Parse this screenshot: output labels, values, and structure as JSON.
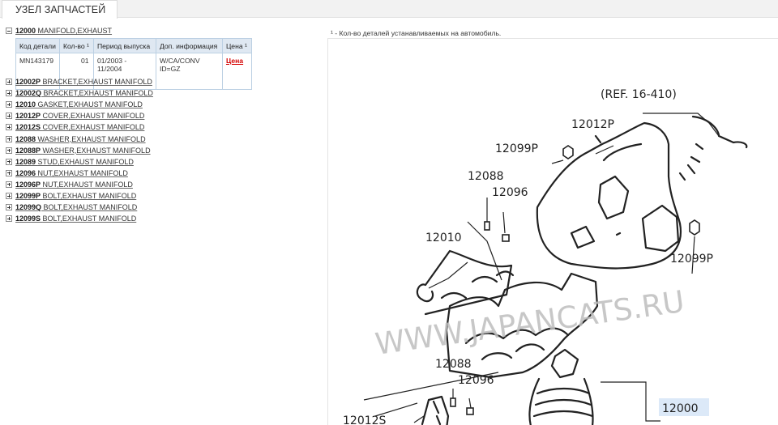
{
  "tab": {
    "label": "УЗЕЛ ЗАПЧАСТЕЙ"
  },
  "tree": {
    "expanded": {
      "code": "12000",
      "name": "MANIFOLD,EXHAUST"
    },
    "table": {
      "headers": [
        "Код детали",
        "Кол-во ¹",
        "Период выпуска",
        "Доп. информация",
        "Цена ¹"
      ],
      "rows": [
        {
          "part": "MN143179",
          "qty": "01",
          "period": "01/2003 - 11/2004",
          "info": "W/CA/CONV ID=GZ",
          "price": "Цена"
        }
      ]
    },
    "items": [
      {
        "code": "12002P",
        "name": "BRACKET,EXHAUST MANIFOLD"
      },
      {
        "code": "12002Q",
        "name": "BRACKET,EXHAUST MANIFOLD"
      },
      {
        "code": "12010",
        "name": "GASKET,EXHAUST MANIFOLD"
      },
      {
        "code": "12012P",
        "name": "COVER,EXHAUST MANIFOLD"
      },
      {
        "code": "12012S",
        "name": "COVER,EXHAUST MANIFOLD"
      },
      {
        "code": "12088",
        "name": "WASHER,EXHAUST MANIFOLD"
      },
      {
        "code": "12088P",
        "name": "WASHER,EXHAUST MANIFOLD"
      },
      {
        "code": "12089",
        "name": "STUD,EXHAUST MANIFOLD"
      },
      {
        "code": "12096",
        "name": "NUT,EXHAUST MANIFOLD"
      },
      {
        "code": "12096P",
        "name": "NUT,EXHAUST MANIFOLD"
      },
      {
        "code": "12099P",
        "name": "BOLT,EXHAUST MANIFOLD"
      },
      {
        "code": "12099Q",
        "name": "BOLT,EXHAUST MANIFOLD"
      },
      {
        "code": "12099S",
        "name": "BOLT,EXHAUST MANIFOLD"
      }
    ]
  },
  "note": "¹ - Кол-во деталей устанавливаемых на автомобиль.",
  "diagram": {
    "labels": {
      "ref": "(REF. 16-410)",
      "l12012P": "12012P",
      "l12099P_a": "12099P",
      "l12088_a": "12088",
      "l12096_a": "12096",
      "l12010": "12010",
      "l12099P_b": "12099P",
      "l12088_b": "12088",
      "l12096_b": "12096",
      "l12012S": "12012S",
      "l12000": "12000"
    },
    "watermark": "WWW.JAPANCATS.RU"
  }
}
